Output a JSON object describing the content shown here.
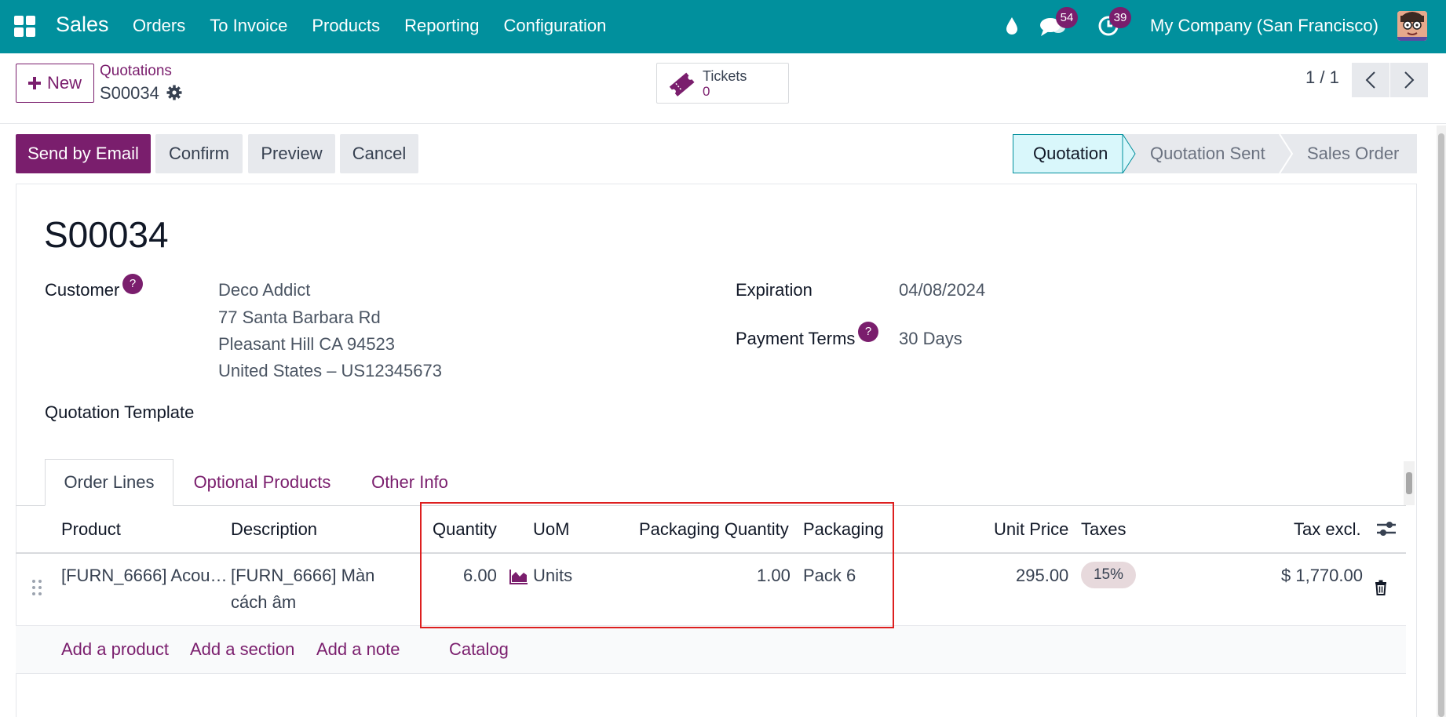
{
  "navbar": {
    "app_name": "Sales",
    "menu": [
      "Orders",
      "To Invoice",
      "Products",
      "Reporting",
      "Configuration"
    ],
    "messages_count": "54",
    "activities_count": "39",
    "company": "My Company (San Francisco)",
    "color": "#01909d"
  },
  "control_panel": {
    "new_label": "New",
    "breadcrumb": "Quotations",
    "record_name": "S00034",
    "smart_button": {
      "label": "Tickets",
      "value": "0"
    },
    "pager": "1 / 1"
  },
  "actions": {
    "send_by_email": "Send by Email",
    "confirm": "Confirm",
    "preview": "Preview",
    "cancel": "Cancel"
  },
  "statusbar": {
    "stages": [
      "Quotation",
      "Quotation Sent",
      "Sales Order"
    ],
    "active": "Quotation"
  },
  "form": {
    "title": "S00034",
    "customer_label": "Customer",
    "customer": {
      "name": "Deco Addict",
      "line1": "77 Santa Barbara Rd",
      "line2": "Pleasant Hill CA 94523",
      "line3": "United States – US12345673"
    },
    "expiration_label": "Expiration",
    "expiration": "04/08/2024",
    "payment_terms_label": "Payment Terms",
    "payment_terms": "30 Days",
    "quotation_template_label": "Quotation Template",
    "help_mark": "?"
  },
  "tabs": [
    "Order Lines",
    "Optional Products",
    "Other Info"
  ],
  "order_lines": {
    "columns": {
      "product": "Product",
      "description": "Description",
      "quantity": "Quantity",
      "uom": "UoM",
      "packaging_quantity": "Packaging Quantity",
      "packaging": "Packaging",
      "unit_price": "Unit Price",
      "taxes": "Taxes",
      "tax_excl": "Tax excl."
    },
    "rows": [
      {
        "product": "[FURN_6666] Acou…",
        "description_line1": "[FURN_6666] Màn",
        "description_line2": "cách âm",
        "quantity": "6.00",
        "uom": "Units",
        "packaging_quantity": "1.00",
        "packaging": "Pack 6",
        "unit_price": "295.00",
        "taxes": "15%",
        "tax_excl": "$ 1,770.00"
      }
    ],
    "add_links": [
      "Add a product",
      "Add a section",
      "Add a note",
      "Catalog"
    ]
  },
  "colors": {
    "brand": "#7a1e6d",
    "active_stage": "#d9f7fb",
    "highlight_box": "#dd1f1f"
  }
}
